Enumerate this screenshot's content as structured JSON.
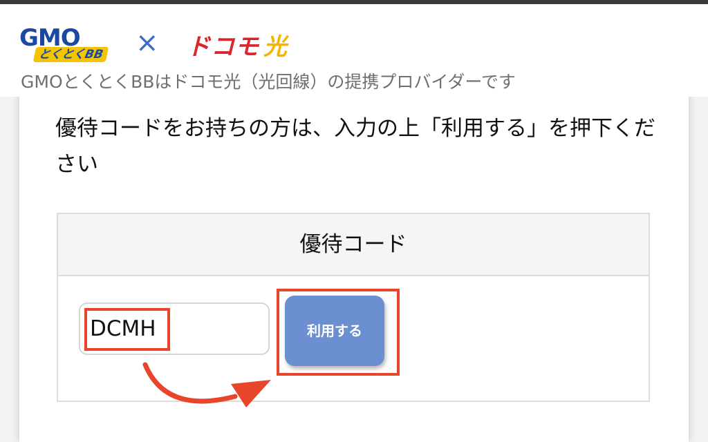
{
  "header": {
    "gmo_logo_text": "GMO",
    "gmo_logo_sub": "とくとくBB",
    "times_sign": "×",
    "docomo_logo_text": "ドコモ",
    "docomo_logo_hikari": "光",
    "tagline": "GMOとくとくBBはドコモ光（光回線）の提携プロバイダーです"
  },
  "main": {
    "instruction": "優待コードをお持ちの方は、入力の上「利用する」を押下ください",
    "table_header": "優待コード",
    "code_value": "DCMH",
    "apply_label": "利用する"
  },
  "colors": {
    "highlight": "#e8452b",
    "button": "#6b8fd0",
    "gmo_blue": "#1a4aa0",
    "docomo_red": "#d8262c",
    "hikari_yellow": "#f2b600"
  },
  "icons": {
    "arrow": "curved-arrow-icon"
  }
}
